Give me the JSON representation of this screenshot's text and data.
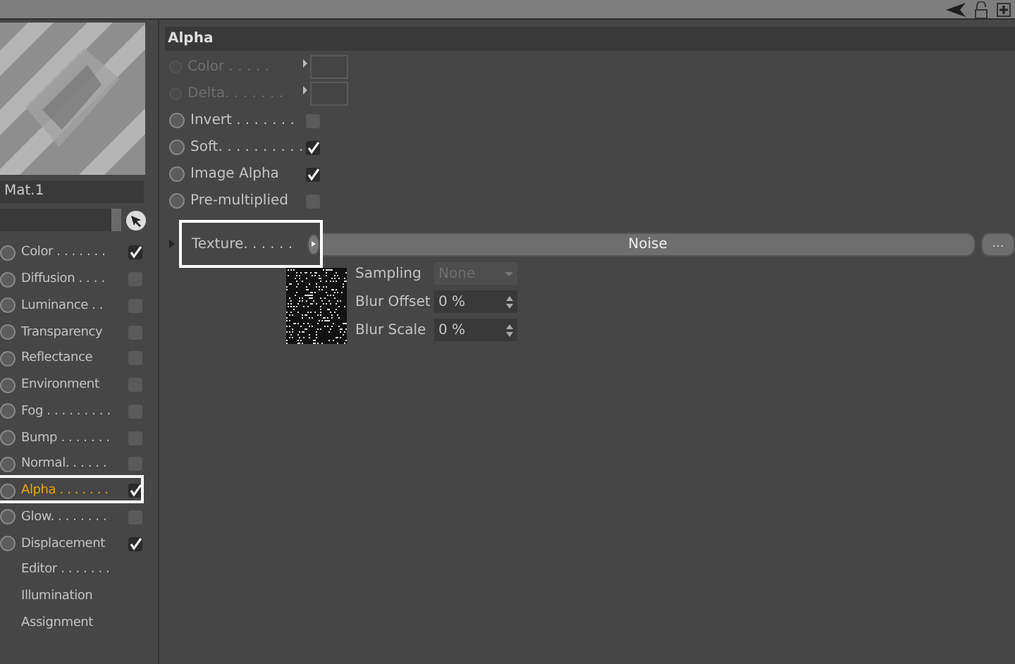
{
  "material": {
    "name": "Mat.1"
  },
  "channels": [
    {
      "kind": "channel",
      "label": "Color . . . . . . .",
      "checked": true,
      "selected": false
    },
    {
      "kind": "channel",
      "label": "Diffusion . . . .",
      "checked": false,
      "selected": false
    },
    {
      "kind": "channel",
      "label": "Luminance . .",
      "checked": false,
      "selected": false
    },
    {
      "kind": "channel",
      "label": "Transparency",
      "checked": false,
      "selected": false
    },
    {
      "kind": "channel",
      "label": "Reflectance",
      "checked": false,
      "selected": false
    },
    {
      "kind": "channel",
      "label": "Environment",
      "checked": false,
      "selected": false
    },
    {
      "kind": "channel",
      "label": "Fog . . . . . . . . .",
      "checked": false,
      "selected": false
    },
    {
      "kind": "channel",
      "label": "Bump . . . . . . .",
      "checked": false,
      "selected": false
    },
    {
      "kind": "channel",
      "label": "Normal. . . . . .",
      "checked": false,
      "selected": false
    },
    {
      "kind": "channel",
      "label": "Alpha . . . . . . .",
      "checked": true,
      "selected": true
    },
    {
      "kind": "channel",
      "label": "Glow. . . . . . . .",
      "checked": false,
      "selected": false
    },
    {
      "kind": "channel",
      "label": "Displacement",
      "checked": true,
      "selected": false
    },
    {
      "kind": "plain",
      "label": "Editor . . . . . . ."
    },
    {
      "kind": "plain",
      "label": "Illumination"
    },
    {
      "kind": "plain",
      "label": "Assignment"
    }
  ],
  "section": {
    "title": "Alpha"
  },
  "params": [
    {
      "kind": "color",
      "label": "Color . . . . .",
      "disabled": true
    },
    {
      "kind": "color",
      "label": "Delta. . . . . . .",
      "disabled": true
    },
    {
      "kind": "check",
      "label": "Invert . . . . . . .",
      "checked": false
    },
    {
      "kind": "check",
      "label": "Soft. . . . . . . . . .",
      "checked": true
    },
    {
      "kind": "check",
      "label": "Image Alpha",
      "checked": true
    },
    {
      "kind": "check",
      "label": "Pre-multiplied",
      "checked": false
    }
  ],
  "texture": {
    "label": "Texture. . . . . .",
    "highlighted": true,
    "shader": "Noise",
    "more_button": "...",
    "settings": [
      {
        "kind": "select",
        "label": "Sampling",
        "value": "None",
        "disabled": true
      },
      {
        "kind": "spin",
        "label": "Blur Offset",
        "value": "0 %"
      },
      {
        "kind": "spin",
        "label": "Blur Scale",
        "value": "0 %"
      }
    ]
  }
}
